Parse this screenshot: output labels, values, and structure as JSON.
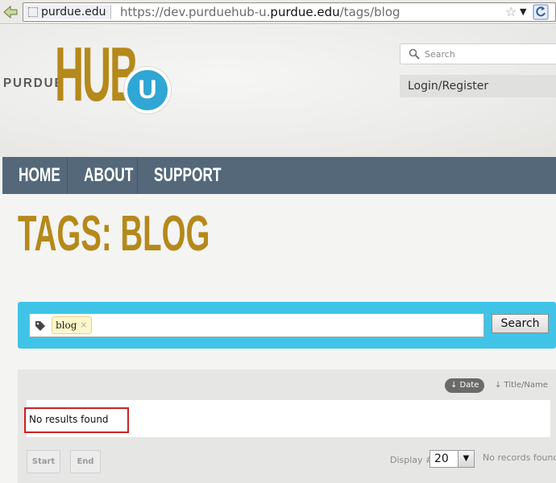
{
  "browser": {
    "site_identity": "purdue.edu",
    "url_prefix": "https://dev.purduehub-u.",
    "url_host": "purdue.edu",
    "url_suffix": "/tags/blog"
  },
  "header": {
    "logo_purdue": "PURDUE",
    "logo_hub": "HUB",
    "logo_u": "U",
    "search_placeholder": "Search",
    "login_label": "Login/Register"
  },
  "nav": {
    "items": [
      {
        "label": "HOME"
      },
      {
        "label": "ABOUT"
      },
      {
        "label": "SUPPORT"
      }
    ]
  },
  "page": {
    "title": "TAGS: BLOG"
  },
  "tag_search": {
    "tag": "blog",
    "remove_glyph": "×",
    "search_button": "Search"
  },
  "results": {
    "sort_date": "↓ Date",
    "sort_title": "↓ Title/Name",
    "empty_message": "No results found",
    "start_button": "Start",
    "end_button": "End",
    "display_label": "Display #",
    "display_value": "20",
    "records_status": "No records found"
  },
  "colors": {
    "brand_gold": "#b5891a",
    "nav_bg": "#54687a",
    "search_panel": "#3fc4e8",
    "logo_u_blue": "#2fa6d4"
  }
}
